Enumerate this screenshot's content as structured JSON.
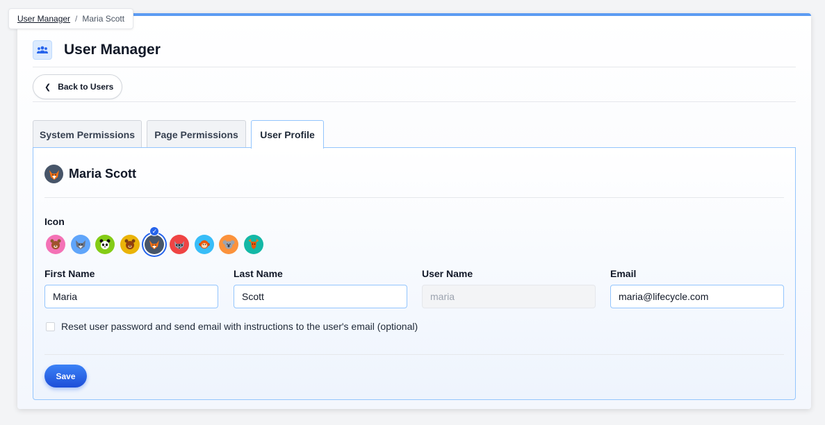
{
  "breadcrumb": {
    "root": "User Manager",
    "separator": "/",
    "current": "Maria Scott"
  },
  "header": {
    "title": "User Manager",
    "icon": "users-icon"
  },
  "back_button": {
    "label": "Back to Users",
    "icon": "chevron-left-icon"
  },
  "tabs": [
    {
      "label": "System Permissions",
      "active": false
    },
    {
      "label": "Page Permissions",
      "active": false
    },
    {
      "label": "User Profile",
      "active": true
    }
  ],
  "profile": {
    "name": "Maria Scott",
    "avatar": "fox-icon",
    "icon_label": "Icon",
    "icons": [
      {
        "name": "bear-pink-icon",
        "color": "#f472b6",
        "selected": false
      },
      {
        "name": "wolf-icon",
        "color": "#60a5fa",
        "selected": false
      },
      {
        "name": "panda-icon",
        "color": "#84cc16",
        "selected": false
      },
      {
        "name": "bear-brown-icon",
        "color": "#eab308",
        "selected": false
      },
      {
        "name": "fox-icon",
        "color": "#475569",
        "selected": true
      },
      {
        "name": "raccoon-icon",
        "color": "#ef4444",
        "selected": false
      },
      {
        "name": "monkey-icon",
        "color": "#38bdf8",
        "selected": false
      },
      {
        "name": "koala-icon",
        "color": "#fb923c",
        "selected": false
      },
      {
        "name": "deer-icon",
        "color": "#14b8a6",
        "selected": false
      }
    ],
    "fields": {
      "first_name": {
        "label": "First Name",
        "value": "Maria"
      },
      "last_name": {
        "label": "Last Name",
        "value": "Scott"
      },
      "user_name": {
        "label": "User Name",
        "value": "maria"
      },
      "email": {
        "label": "Email",
        "value": "maria@lifecycle.com"
      }
    },
    "reset_password_label": "Reset user password and send email with instructions to the user's email (optional)",
    "save_label": "Save"
  },
  "colors": {
    "accent": "#2563eb",
    "top_bar": "#5b9bf2",
    "panel_border": "#93c5fd"
  }
}
